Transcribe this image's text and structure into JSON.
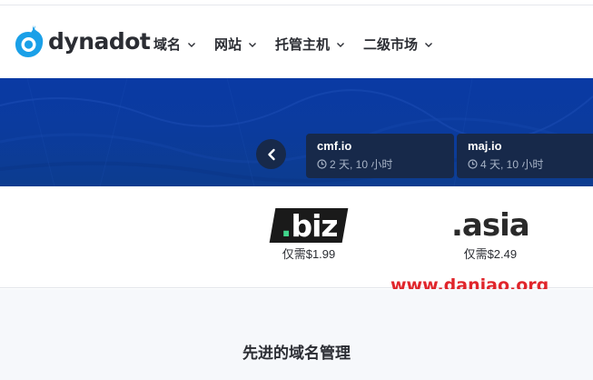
{
  "brand": {
    "logo_text": "dynadot",
    "accent": "#1aa0e8"
  },
  "nav": {
    "items": [
      {
        "label": "域名",
        "icon": "chevron-down-icon"
      },
      {
        "label": "网站",
        "icon": "chevron-down-icon"
      },
      {
        "label": "托管主机",
        "icon": "chevron-down-icon"
      },
      {
        "label": "二级市场",
        "icon": "chevron-down-icon"
      }
    ]
  },
  "hero": {
    "background": "#0b3b9e",
    "prev_icon": "chevron-left-icon",
    "auctions": [
      {
        "domain": "cmf.io",
        "time_left": "2 天, 10 小时",
        "icon": "clock-icon"
      },
      {
        "domain": "maj.io",
        "time_left": "4 天, 10 小时",
        "icon": "clock-icon"
      }
    ]
  },
  "promos": [
    {
      "tld": "biz",
      "dot": ".",
      "price": "仅需$1.99",
      "dot_color": "#41d58c"
    },
    {
      "tld": "asia",
      "dot": ".",
      "price": "仅需$2.49"
    }
  ],
  "watermark": {
    "text": "www.daniao.org",
    "color": "#e0252b"
  },
  "section": {
    "title": "先进的域名管理"
  }
}
